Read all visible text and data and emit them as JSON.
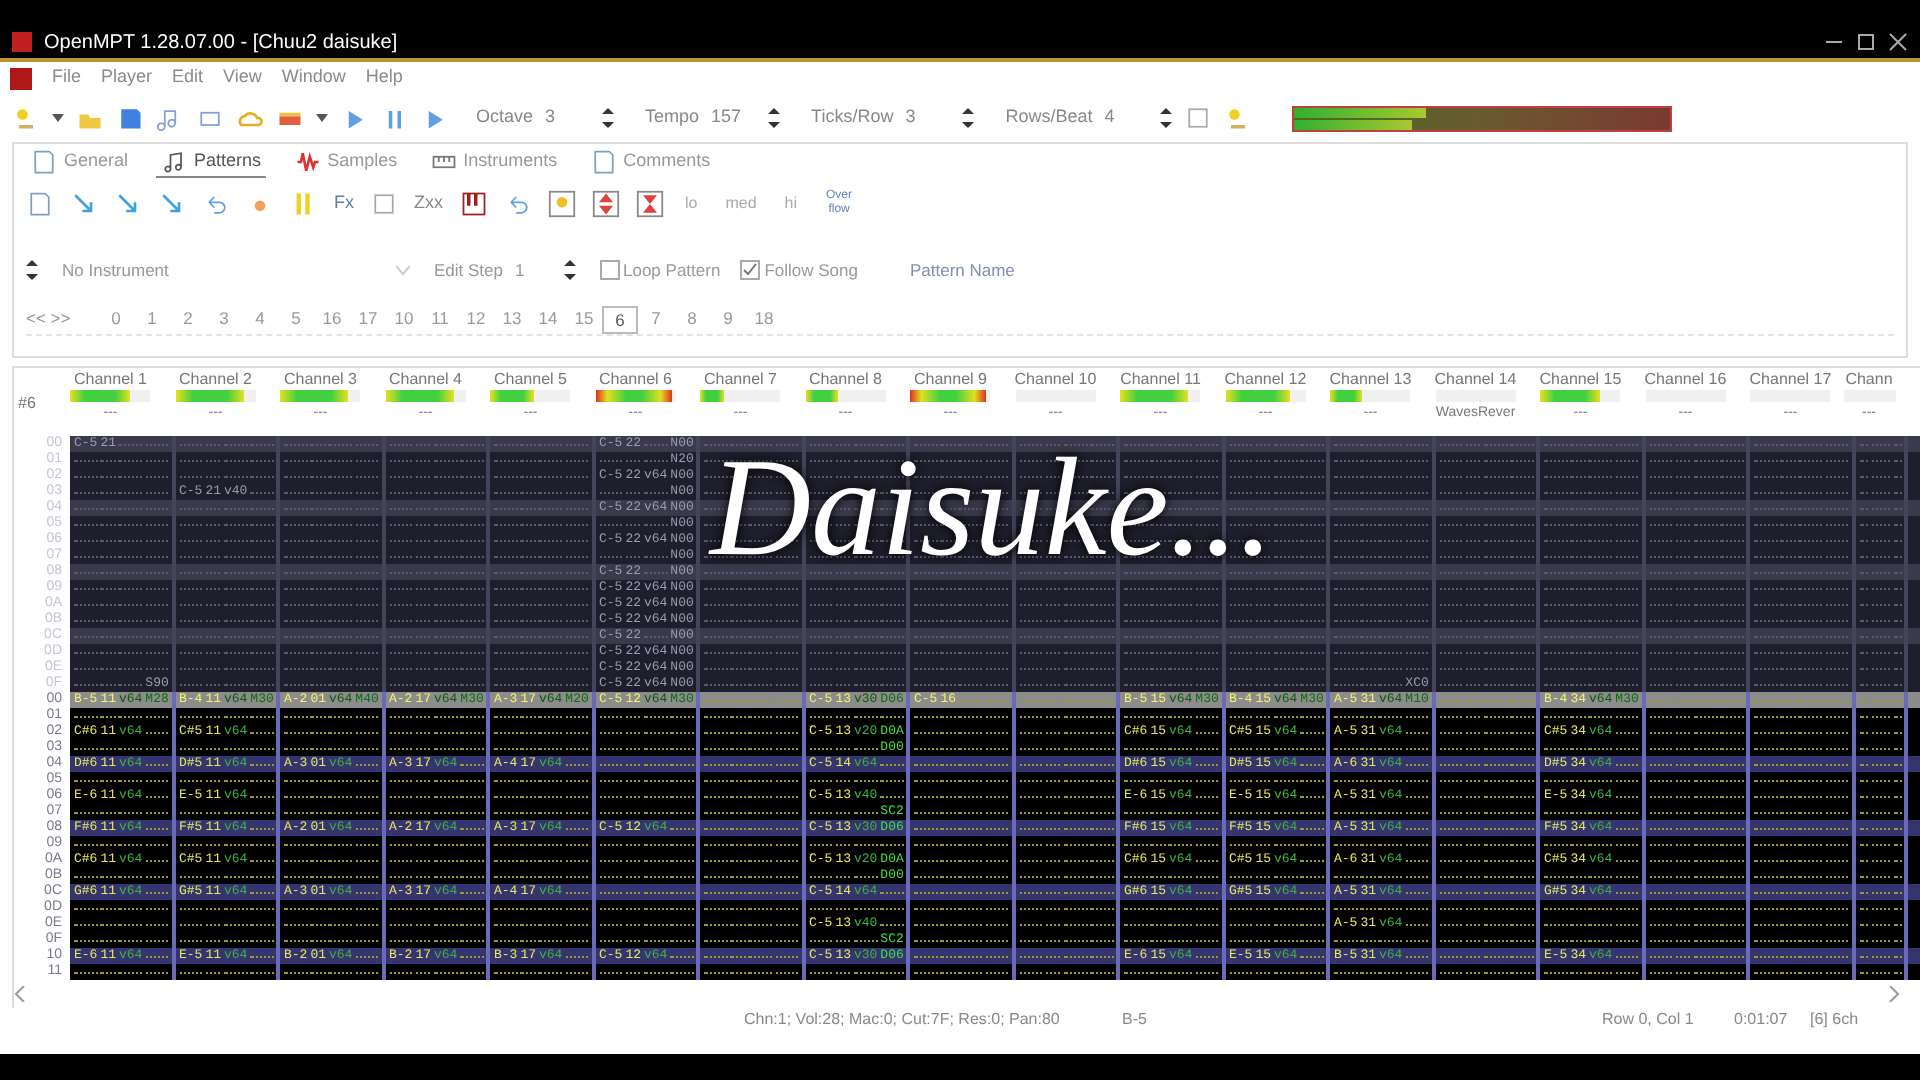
{
  "window": {
    "title": "OpenMPT 1.28.07.00 - [Chuu2 daisuke]"
  },
  "menu": [
    "File",
    "Player",
    "Edit",
    "View",
    "Window",
    "Help"
  ],
  "spin_fields": [
    {
      "label": "Octave",
      "value": "3"
    },
    {
      "label": "Tempo",
      "value": "157"
    },
    {
      "label": "Ticks/Row",
      "value": "3"
    },
    {
      "label": "Rows/Beat",
      "value": "4"
    }
  ],
  "master_vu": [
    {
      "level": 0.35
    },
    {
      "level": 0.31
    }
  ],
  "tabs": [
    {
      "label": "General",
      "selected": false
    },
    {
      "label": "Patterns",
      "selected": true
    },
    {
      "label": "Samples",
      "selected": false
    },
    {
      "label": "Instruments",
      "selected": false
    },
    {
      "label": "Comments",
      "selected": false
    }
  ],
  "pattern_toolbar": {
    "fx_button": "Fx",
    "zxx_button": "Zxx",
    "speed_buttons": [
      "lo",
      "med",
      "hi"
    ],
    "overflow_button": "Over flow"
  },
  "instrument": {
    "value": "No Instrument"
  },
  "edit_step": {
    "label": "Edit Step",
    "value": "1"
  },
  "loop_pattern": {
    "label": "Loop Pattern",
    "checked": false
  },
  "follow_song": {
    "label": "Follow Song",
    "checked": true
  },
  "pattern_name": {
    "label": "Pattern Name"
  },
  "orders": {
    "nav": "<< >>",
    "items": [
      {
        "label": "0",
        "selected": false
      },
      {
        "label": "1",
        "selected": false
      },
      {
        "label": "2",
        "selected": false
      },
      {
        "label": "3",
        "selected": false
      },
      {
        "label": "4",
        "selected": false
      },
      {
        "label": "5",
        "selected": false
      },
      {
        "label": "16",
        "selected": false
      },
      {
        "label": "17",
        "selected": false
      },
      {
        "label": "10",
        "selected": false
      },
      {
        "label": "11",
        "selected": false
      },
      {
        "label": "12",
        "selected": false
      },
      {
        "label": "13",
        "selected": false
      },
      {
        "label": "14",
        "selected": false
      },
      {
        "label": "15",
        "selected": false
      },
      {
        "label": "6",
        "selected": true
      },
      {
        "label": "7",
        "selected": false
      },
      {
        "label": "8",
        "selected": false
      },
      {
        "label": "9",
        "selected": false
      },
      {
        "label": "18",
        "selected": false
      }
    ]
  },
  "pattern_number": "#6",
  "channels": [
    {
      "name": "Channel 1",
      "plugin": "---",
      "level": 0.75,
      "clipping": false
    },
    {
      "name": "Channel 2",
      "plugin": "---",
      "level": 0.85,
      "clipping": false
    },
    {
      "name": "Channel 3",
      "plugin": "---",
      "level": 0.85,
      "clipping": false
    },
    {
      "name": "Channel 4",
      "plugin": "---",
      "level": 0.85,
      "clipping": false
    },
    {
      "name": "Channel 5",
      "plugin": "---",
      "level": 0.55,
      "clipping": false
    },
    {
      "name": "Channel 6",
      "plugin": "---",
      "level": 0.95,
      "clipping": true
    },
    {
      "name": "Channel 7",
      "plugin": "---",
      "level": 0.3,
      "clipping": false
    },
    {
      "name": "Channel 8",
      "plugin": "---",
      "level": 0.4,
      "clipping": false
    },
    {
      "name": "Channel 9",
      "plugin": "---",
      "level": 0.95,
      "clipping": true
    },
    {
      "name": "Channel 10",
      "plugin": "---",
      "level": 0
    },
    {
      "name": "Channel 11",
      "plugin": "---",
      "level": 0.85,
      "clipping": false
    },
    {
      "name": "Channel 12",
      "plugin": "---",
      "level": 0.8,
      "clipping": false
    },
    {
      "name": "Channel 13",
      "plugin": "---",
      "level": 0.4,
      "clipping": false
    },
    {
      "name": "Channel 14",
      "plugin": "WavesRever",
      "level": 0
    },
    {
      "name": "Channel 15",
      "plugin": "---",
      "level": 0.75,
      "clipping": false
    },
    {
      "name": "Channel 16",
      "plugin": "---",
      "level": 0
    },
    {
      "name": "Channel 17",
      "plugin": "---",
      "level": 0
    },
    {
      "name": "Chann",
      "plugin": "---",
      "level": 0
    }
  ],
  "previous_rows": [
    {
      "label": "00",
      "beat": true,
      "playing": false,
      "cells": [
        [
          "C-5",
          "21",
          null,
          null
        ],
        null,
        null,
        null,
        null,
        [
          "C-5",
          "22",
          null,
          "N00"
        ],
        null,
        null,
        null,
        null,
        null,
        null,
        null,
        null,
        null,
        null,
        null,
        null
      ]
    },
    {
      "label": "01",
      "beat": false,
      "playing": false,
      "cells": [
        null,
        null,
        null,
        null,
        null,
        [
          null,
          null,
          null,
          "N20"
        ],
        null,
        null,
        null,
        null,
        null,
        null,
        null,
        null,
        null,
        null,
        null,
        null
      ]
    },
    {
      "label": "02",
      "beat": false,
      "playing": false,
      "cells": [
        null,
        null,
        null,
        null,
        null,
        [
          "C-5",
          "22",
          "v64",
          "N00"
        ],
        null,
        null,
        null,
        null,
        null,
        null,
        null,
        null,
        null,
        null,
        null,
        null
      ]
    },
    {
      "label": "03",
      "beat": false,
      "playing": false,
      "cells": [
        null,
        [
          "C-5",
          "21",
          "v40",
          null
        ],
        null,
        null,
        null,
        [
          null,
          null,
          null,
          "N00"
        ],
        null,
        null,
        null,
        null,
        null,
        null,
        null,
        null,
        null,
        null,
        null,
        null
      ]
    },
    {
      "label": "04",
      "beat": true,
      "playing": false,
      "cells": [
        null,
        null,
        null,
        null,
        null,
        [
          "C-5",
          "22",
          "v64",
          "N00"
        ],
        null,
        null,
        null,
        null,
        null,
        null,
        null,
        null,
        null,
        null,
        null,
        null
      ]
    },
    {
      "label": "05",
      "beat": false,
      "playing": false,
      "cells": [
        null,
        null,
        null,
        null,
        null,
        [
          null,
          null,
          null,
          "N00"
        ],
        null,
        null,
        null,
        null,
        null,
        null,
        null,
        null,
        null,
        null,
        null,
        null
      ]
    },
    {
      "label": "06",
      "beat": false,
      "playing": false,
      "cells": [
        null,
        null,
        null,
        null,
        null,
        [
          "C-5",
          "22",
          "v64",
          "N00"
        ],
        null,
        null,
        null,
        null,
        null,
        null,
        null,
        null,
        null,
        null,
        null,
        null
      ]
    },
    {
      "label": "07",
      "beat": false,
      "playing": false,
      "cells": [
        null,
        null,
        null,
        null,
        null,
        [
          null,
          null,
          null,
          "N00"
        ],
        null,
        null,
        null,
        null,
        null,
        null,
        null,
        null,
        null,
        null,
        null,
        null
      ]
    },
    {
      "label": "08",
      "beat": true,
      "playing": false,
      "cells": [
        null,
        null,
        null,
        null,
        null,
        [
          "C-5",
          "22",
          null,
          "N00"
        ],
        null,
        null,
        null,
        null,
        null,
        null,
        null,
        null,
        null,
        null,
        null,
        null
      ]
    },
    {
      "label": "09",
      "beat": false,
      "playing": false,
      "cells": [
        null,
        null,
        null,
        null,
        null,
        [
          "C-5",
          "22",
          "v64",
          "N00"
        ],
        null,
        null,
        null,
        null,
        null,
        null,
        null,
        null,
        null,
        null,
        null,
        null
      ]
    },
    {
      "label": "0A",
      "beat": false,
      "playing": false,
      "cells": [
        null,
        null,
        null,
        null,
        null,
        [
          "C-5",
          "22",
          "v64",
          "N00"
        ],
        null,
        null,
        null,
        null,
        null,
        null,
        null,
        null,
        null,
        null,
        null,
        null
      ]
    },
    {
      "label": "0B",
      "beat": false,
      "playing": false,
      "cells": [
        null,
        null,
        null,
        null,
        null,
        [
          "C-5",
          "22",
          "v64",
          "N00"
        ],
        null,
        null,
        null,
        null,
        null,
        null,
        null,
        null,
        null,
        null,
        null,
        null
      ]
    },
    {
      "label": "0C",
      "beat": true,
      "playing": false,
      "cells": [
        null,
        null,
        null,
        null,
        null,
        [
          "C-5",
          "22",
          null,
          "N00"
        ],
        null,
        null,
        null,
        null,
        null,
        null,
        null,
        null,
        null,
        null,
        null,
        null
      ]
    },
    {
      "label": "0D",
      "beat": false,
      "playing": false,
      "cells": [
        null,
        null,
        null,
        null,
        null,
        [
          "C-5",
          "22",
          "v64",
          "N00"
        ],
        null,
        null,
        null,
        null,
        null,
        null,
        null,
        null,
        null,
        null,
        null,
        null
      ]
    },
    {
      "label": "0E",
      "beat": false,
      "playing": false,
      "cells": [
        null,
        null,
        null,
        null,
        null,
        [
          "C-5",
          "22",
          "v64",
          "N00"
        ],
        null,
        null,
        null,
        null,
        null,
        null,
        null,
        null,
        null,
        null,
        null,
        null
      ]
    },
    {
      "label": "0F",
      "beat": false,
      "playing": false,
      "cells": [
        [
          null,
          null,
          null,
          "S90"
        ],
        null,
        null,
        null,
        null,
        [
          "C-5",
          "22",
          "v64",
          "N00"
        ],
        null,
        null,
        null,
        null,
        null,
        null,
        [
          null,
          null,
          null,
          "XC0"
        ],
        null,
        null,
        null,
        null,
        null
      ]
    }
  ],
  "rows": [
    {
      "label": "00",
      "playing": true,
      "cells": [
        [
          "B-5",
          "11",
          "v64",
          "M28"
        ],
        [
          "B-4",
          "11",
          "v64",
          "M30"
        ],
        [
          "A-2",
          "01",
          "v64",
          "M40"
        ],
        [
          "A-2",
          "17",
          "v64",
          "M30"
        ],
        [
          "A-3",
          "17",
          "v64",
          "M20"
        ],
        [
          "C-5",
          "12",
          "v64",
          "M30"
        ],
        null,
        [
          "C-5",
          "13",
          "v30",
          "D06"
        ],
        [
          "C-5",
          "16",
          null,
          null
        ],
        null,
        [
          "B-5",
          "15",
          "v64",
          "M30"
        ],
        [
          "B-4",
          "15",
          "v64",
          "M30"
        ],
        [
          "A-5",
          "31",
          "v64",
          "M10"
        ],
        null,
        [
          "B-4",
          "34",
          "v64",
          "M30"
        ],
        null,
        null,
        null
      ]
    },
    {
      "label": "01",
      "beat": false,
      "playing": false,
      "cells": [
        null,
        null,
        null,
        null,
        null,
        null,
        null,
        null,
        null,
        null,
        null,
        null,
        null,
        null,
        null,
        null,
        null,
        null
      ]
    },
    {
      "label": "02",
      "beat": false,
      "playing": false,
      "cells": [
        [
          "C#6",
          "11",
          "v64",
          null
        ],
        [
          "C#5",
          "11",
          "v64",
          null
        ],
        null,
        null,
        null,
        null,
        null,
        [
          "C-5",
          "13",
          "v20",
          "D0A"
        ],
        null,
        null,
        [
          "C#6",
          "15",
          "v64",
          null
        ],
        [
          "C#5",
          "15",
          "v64",
          null
        ],
        [
          "A-5",
          "31",
          "v64",
          null
        ],
        null,
        [
          "C#5",
          "34",
          "v64",
          null
        ],
        null,
        null,
        null
      ]
    },
    {
      "label": "03",
      "beat": false,
      "playing": false,
      "cells": [
        null,
        null,
        null,
        null,
        null,
        null,
        null,
        [
          null,
          null,
          null,
          "D00"
        ],
        null,
        null,
        null,
        null,
        null,
        null,
        null,
        null,
        null,
        null
      ]
    },
    {
      "label": "04",
      "beat": true,
      "playing": false,
      "cells": [
        [
          "D#6",
          "11",
          "v64",
          null
        ],
        [
          "D#5",
          "11",
          "v64",
          null
        ],
        [
          "A-3",
          "01",
          "v64",
          null
        ],
        [
          "A-3",
          "17",
          "v64",
          null
        ],
        [
          "A-4",
          "17",
          "v64",
          null
        ],
        null,
        null,
        [
          "C-5",
          "14",
          "v64",
          null
        ],
        null,
        null,
        [
          "D#6",
          "15",
          "v64",
          null
        ],
        [
          "D#5",
          "15",
          "v64",
          null
        ],
        [
          "A-6",
          "31",
          "v64",
          null
        ],
        null,
        [
          "D#5",
          "34",
          "v64",
          null
        ],
        null,
        null,
        null
      ]
    },
    {
      "label": "05",
      "beat": false,
      "playing": false,
      "cells": [
        null,
        null,
        null,
        null,
        null,
        null,
        null,
        null,
        null,
        null,
        null,
        null,
        null,
        null,
        null,
        null,
        null,
        null
      ]
    },
    {
      "label": "06",
      "beat": false,
      "playing": false,
      "cells": [
        [
          "E-6",
          "11",
          "v64",
          null
        ],
        [
          "E-5",
          "11",
          "v64",
          null
        ],
        null,
        null,
        null,
        null,
        null,
        [
          "C-5",
          "13",
          "v40",
          null
        ],
        null,
        null,
        [
          "E-6",
          "15",
          "v64",
          null
        ],
        [
          "E-5",
          "15",
          "v64",
          null
        ],
        [
          "A-5",
          "31",
          "v64",
          null
        ],
        null,
        [
          "E-5",
          "34",
          "v64",
          null
        ],
        null,
        null,
        null
      ]
    },
    {
      "label": "07",
      "beat": false,
      "playing": false,
      "cells": [
        null,
        null,
        null,
        null,
        null,
        null,
        null,
        [
          null,
          null,
          null,
          "SC2"
        ],
        null,
        null,
        null,
        null,
        null,
        null,
        null,
        null,
        null,
        null
      ]
    },
    {
      "label": "08",
      "beat": true,
      "playing": false,
      "cells": [
        [
          "F#6",
          "11",
          "v64",
          null
        ],
        [
          "F#5",
          "11",
          "v64",
          null
        ],
        [
          "A-2",
          "01",
          "v64",
          null
        ],
        [
          "A-2",
          "17",
          "v64",
          null
        ],
        [
          "A-3",
          "17",
          "v64",
          null
        ],
        [
          "C-5",
          "12",
          "v64",
          null
        ],
        null,
        [
          "C-5",
          "13",
          "v30",
          "D06"
        ],
        null,
        null,
        [
          "F#6",
          "15",
          "v64",
          null
        ],
        [
          "F#5",
          "15",
          "v64",
          null
        ],
        [
          "A-5",
          "31",
          "v64",
          null
        ],
        null,
        [
          "F#5",
          "34",
          "v64",
          null
        ],
        null,
        null,
        null
      ]
    },
    {
      "label": "09",
      "beat": false,
      "playing": false,
      "cells": [
        null,
        null,
        null,
        null,
        null,
        null,
        null,
        null,
        null,
        null,
        null,
        null,
        null,
        null,
        null,
        null,
        null,
        null
      ]
    },
    {
      "label": "0A",
      "beat": false,
      "playing": false,
      "cells": [
        [
          "C#6",
          "11",
          "v64",
          null
        ],
        [
          "C#5",
          "11",
          "v64",
          null
        ],
        null,
        null,
        null,
        null,
        null,
        [
          "C-5",
          "13",
          "v20",
          "D0A"
        ],
        null,
        null,
        [
          "C#6",
          "15",
          "v64",
          null
        ],
        [
          "C#5",
          "15",
          "v64",
          null
        ],
        [
          "A-6",
          "31",
          "v64",
          null
        ],
        null,
        [
          "C#5",
          "34",
          "v64",
          null
        ],
        null,
        null,
        null
      ]
    },
    {
      "label": "0B",
      "beat": false,
      "playing": false,
      "cells": [
        null,
        null,
        null,
        null,
        null,
        null,
        null,
        [
          null,
          null,
          null,
          "D00"
        ],
        null,
        null,
        null,
        null,
        null,
        null,
        null,
        null,
        null,
        null
      ]
    },
    {
      "label": "0C",
      "beat": true,
      "playing": false,
      "cells": [
        [
          "G#6",
          "11",
          "v64",
          null
        ],
        [
          "G#5",
          "11",
          "v64",
          null
        ],
        [
          "A-3",
          "01",
          "v64",
          null
        ],
        [
          "A-3",
          "17",
          "v64",
          null
        ],
        [
          "A-4",
          "17",
          "v64",
          null
        ],
        null,
        null,
        [
          "C-5",
          "14",
          "v64",
          null
        ],
        null,
        null,
        [
          "G#6",
          "15",
          "v64",
          null
        ],
        [
          "G#5",
          "15",
          "v64",
          null
        ],
        [
          "A-5",
          "31",
          "v64",
          null
        ],
        null,
        [
          "G#5",
          "34",
          "v64",
          null
        ],
        null,
        null,
        null
      ]
    },
    {
      "label": "0D",
      "beat": false,
      "playing": false,
      "cells": [
        null,
        null,
        null,
        null,
        null,
        null,
        null,
        null,
        null,
        null,
        null,
        null,
        null,
        null,
        null,
        null,
        null,
        null
      ]
    },
    {
      "label": "0E",
      "beat": false,
      "playing": false,
      "cells": [
        null,
        null,
        null,
        null,
        null,
        null,
        null,
        [
          "C-5",
          "13",
          "v40",
          null
        ],
        null,
        null,
        null,
        null,
        [
          "A-5",
          "31",
          "v64",
          null
        ],
        null,
        null,
        null,
        null,
        null
      ]
    },
    {
      "label": "0F",
      "beat": false,
      "playing": false,
      "cells": [
        null,
        null,
        null,
        null,
        null,
        null,
        null,
        [
          null,
          null,
          null,
          "SC2"
        ],
        null,
        null,
        null,
        null,
        null,
        null,
        null,
        null,
        null,
        null
      ]
    },
    {
      "label": "10",
      "beat": true,
      "playing": false,
      "cells": [
        [
          "E-6",
          "11",
          "v64",
          null
        ],
        [
          "E-5",
          "11",
          "v64",
          null
        ],
        [
          "B-2",
          "01",
          "v64",
          null
        ],
        [
          "B-2",
          "17",
          "v64",
          null
        ],
        [
          "B-3",
          "17",
          "v64",
          null
        ],
        [
          "C-5",
          "12",
          "v64",
          null
        ],
        null,
        [
          "C-5",
          "13",
          "v30",
          "D06"
        ],
        null,
        null,
        [
          "E-6",
          "15",
          "v64",
          null
        ],
        [
          "E-5",
          "15",
          "v64",
          null
        ],
        [
          "B-5",
          "31",
          "v64",
          null
        ],
        null,
        [
          "E-5",
          "34",
          "v64",
          null
        ],
        null,
        null,
        null
      ]
    },
    {
      "label": "11",
      "beat": false,
      "playing": false,
      "cells": [
        null,
        null,
        null,
        null,
        null,
        null,
        null,
        null,
        null,
        null,
        null,
        null,
        null,
        null,
        null,
        null,
        null,
        null
      ]
    }
  ],
  "overlay_title": "Daisuke...",
  "status_bar": {
    "instrument_info": "Chn:1; Vol:28; Mac:0; Cut:7F; Res:0; Pan:80",
    "note": "B-5",
    "position": "Row 0, Col 1",
    "time": "0:01:07",
    "pattern_info": "[6] 6ch"
  }
}
